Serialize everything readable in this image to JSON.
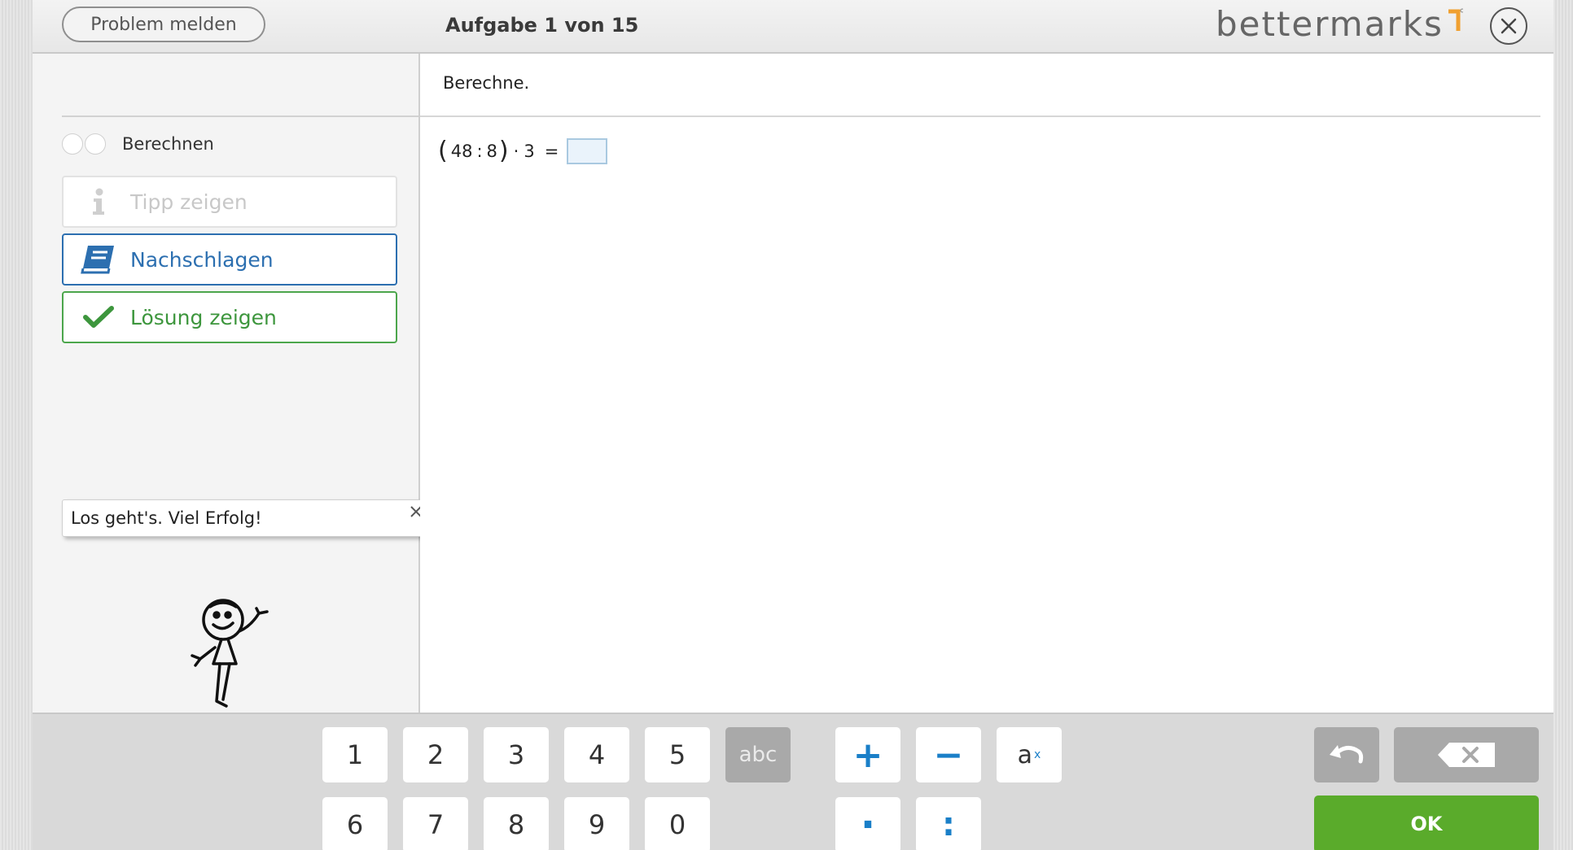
{
  "header": {
    "report_label": "Problem melden",
    "task_counter": "Aufgabe 1 von 15",
    "brand": "bettermarks",
    "brand_color": "#f0a030"
  },
  "sidebar": {
    "progress_label": "Berechnen",
    "progress_dots": 2,
    "buttons": {
      "tip": "Tipp zeigen",
      "lookup": "Nachschlagen",
      "solution": "Lösung zeigen"
    },
    "speech_bubble": "Los geht's. Viel Erfolg!"
  },
  "content": {
    "instruction": "Berechne.",
    "expression": {
      "open_paren": "(",
      "dividend": "48",
      "divide_op": ":",
      "divisor": "8",
      "close_paren": ")",
      "multiply_op": "·",
      "factor": "3",
      "equals": "="
    },
    "answer_value": ""
  },
  "keypad": {
    "digits_row1": [
      "1",
      "2",
      "3",
      "4",
      "5"
    ],
    "digits_row2": [
      "6",
      "7",
      "8",
      "9",
      "0"
    ],
    "abc": "abc",
    "plus": "+",
    "minus": "−",
    "dot": "·",
    "colon": ":",
    "power_base": "a",
    "power_exp": "x",
    "ok": "OK"
  },
  "colors": {
    "lookup_blue": "#2c6fb0",
    "solution_green": "#3d963d",
    "ok_green": "#5aab2b",
    "operator_blue": "#1a7fc8"
  }
}
